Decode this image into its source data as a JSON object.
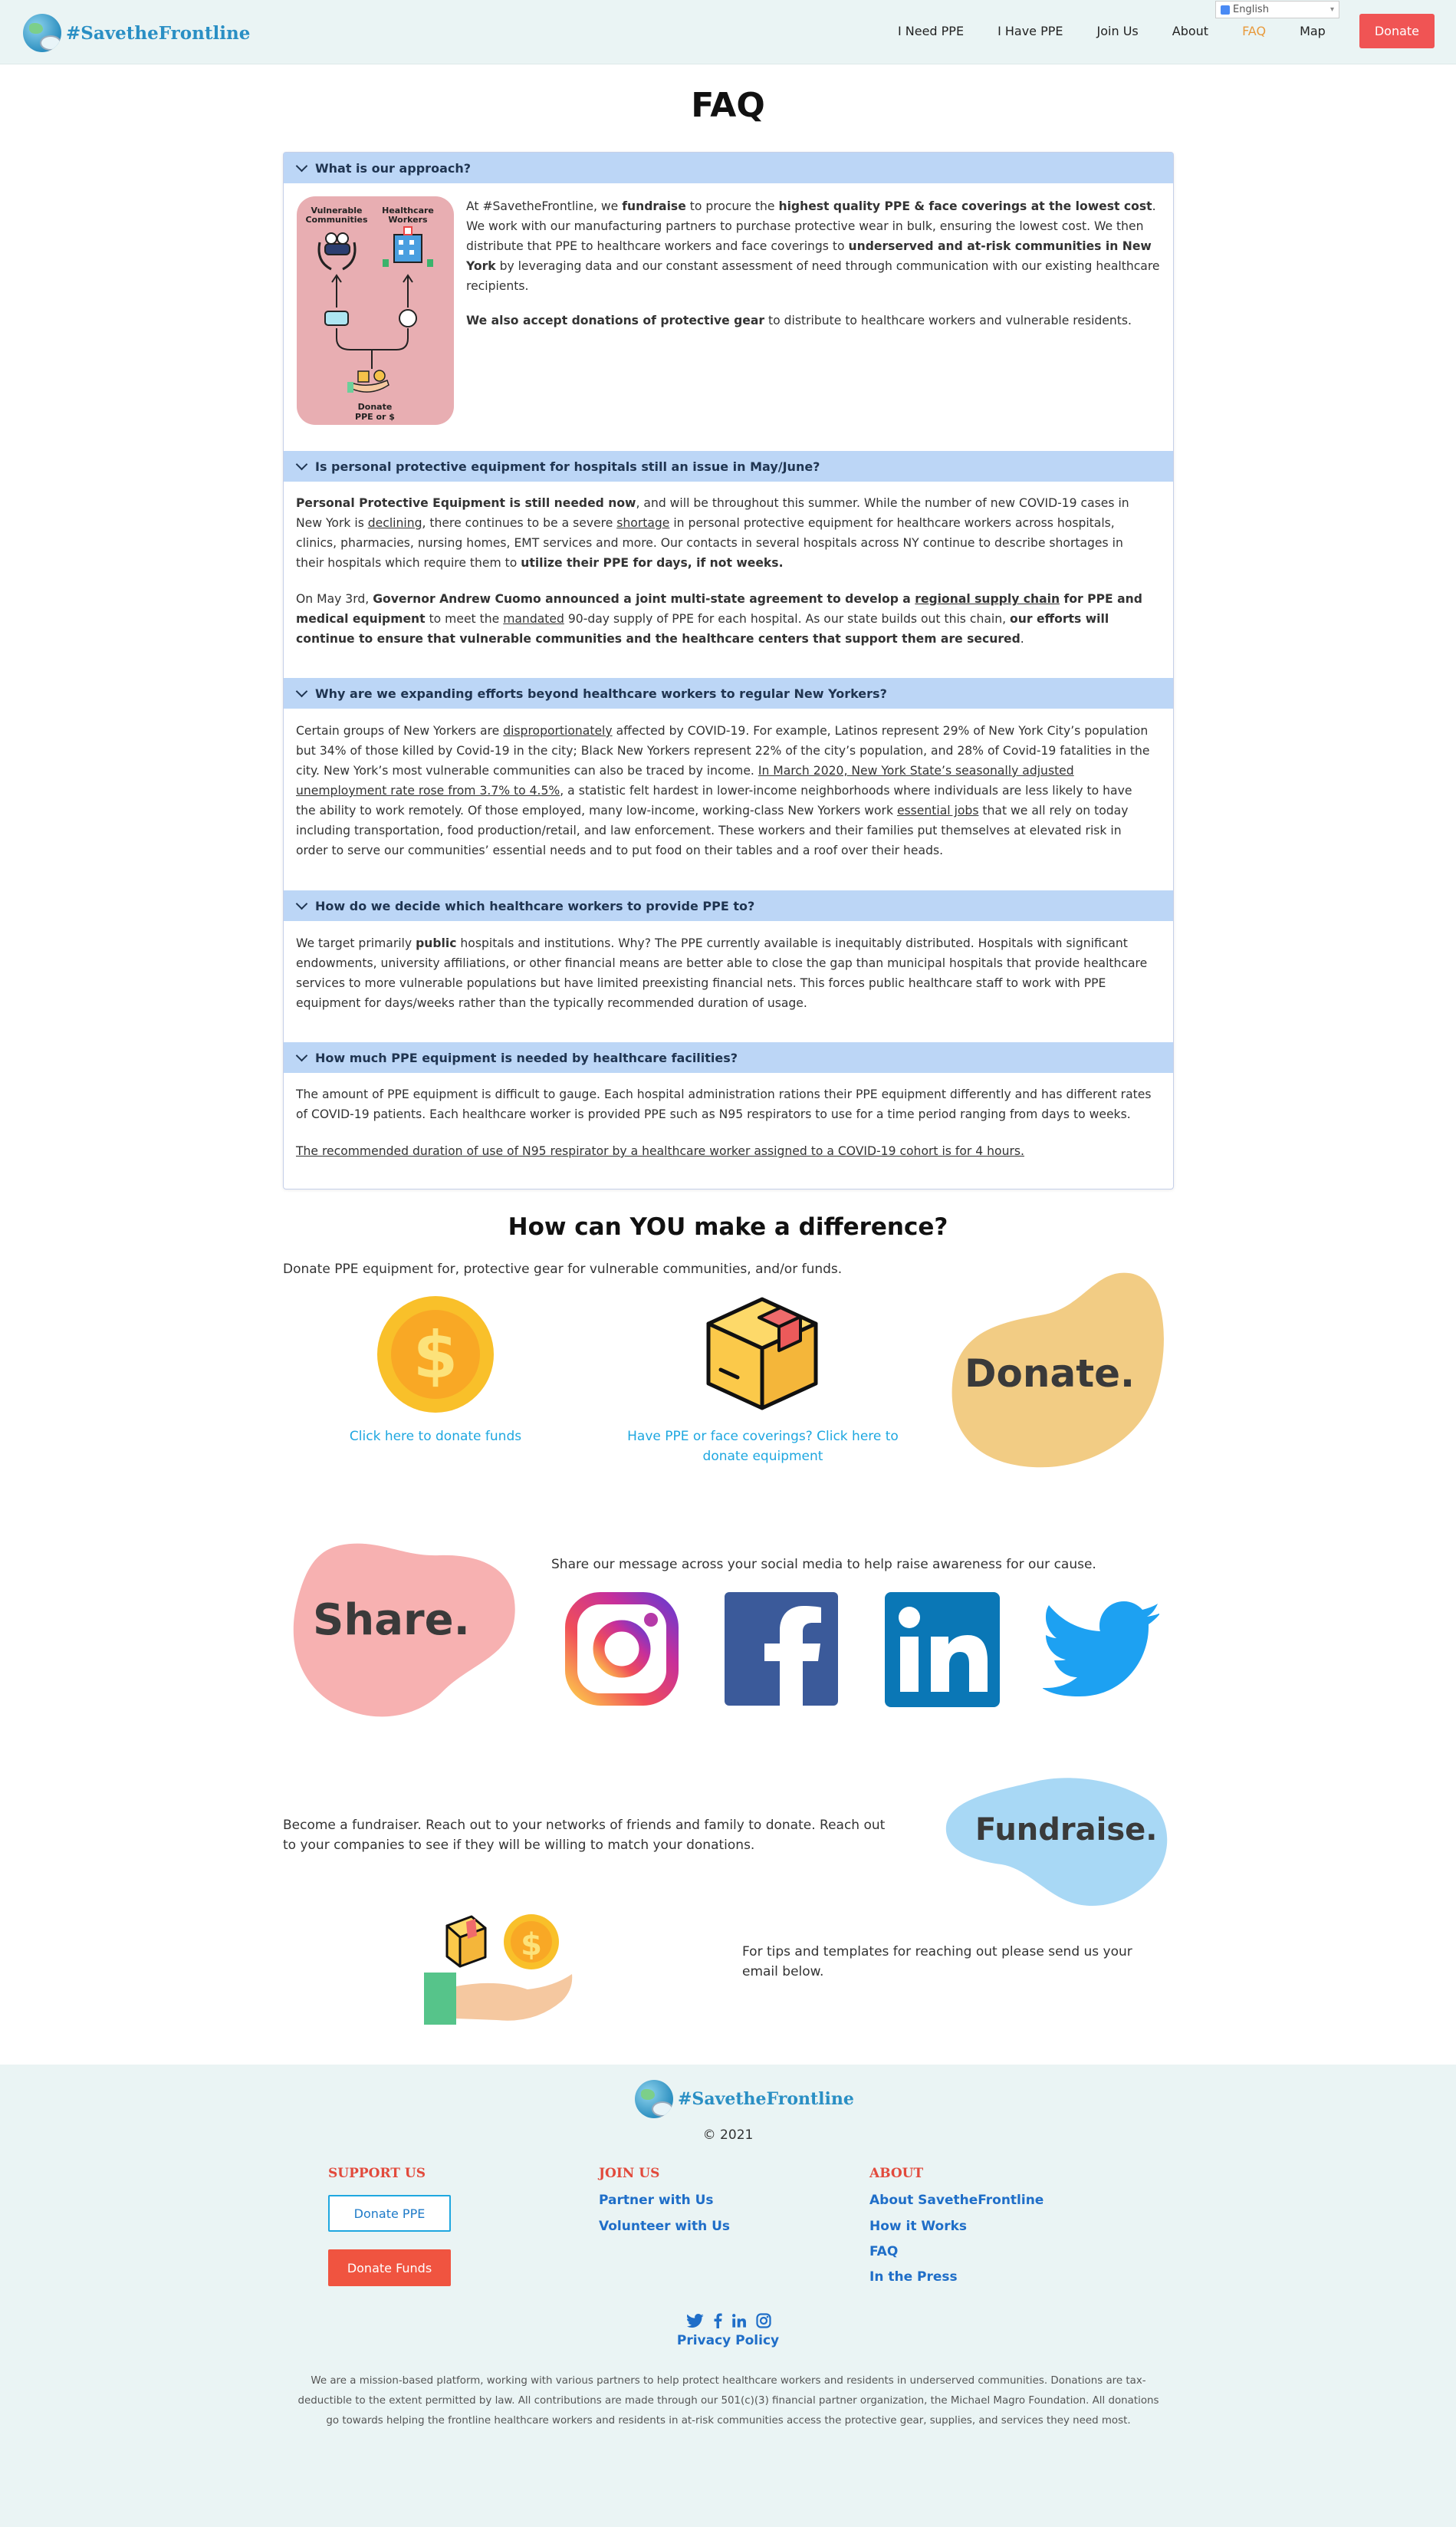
{
  "header": {
    "logo_text": "#SavetheFrontline",
    "language": "English",
    "nav": [
      "I Need PPE",
      "I Have PPE",
      "Join Us",
      "About",
      "FAQ",
      "Map"
    ],
    "donate": "Donate"
  },
  "faq": {
    "title": "FAQ",
    "q1": {
      "question": "What is our approach?",
      "graphic_labels": {
        "vulnerable": "Vulnerable Communities",
        "healthcare": "Healthcare Workers",
        "donate": "Donate PPE or $"
      },
      "p1": [
        {
          "t": "At #SavetheFrontline, we "
        },
        {
          "t": "fundraise",
          "b": true
        },
        {
          "t": " to procure the "
        },
        {
          "t": "highest quality PPE & face coverings at the lowest cost",
          "b": true
        },
        {
          "t": ". We work with our manufacturing partners to purchase protective wear in bulk, ensuring the lowest cost. We then distribute that PPE to healthcare workers and face coverings to "
        },
        {
          "t": "underserved and at-risk communities in New York",
          "b": true
        },
        {
          "t": " by leveraging data and our constant assessment of need through communication with our existing healthcare recipients."
        }
      ],
      "p2": [
        {
          "t": "We also accept donations of protective gear",
          "b": true
        },
        {
          "t": " to distribute to healthcare workers and vulnerable residents."
        }
      ]
    },
    "q2": {
      "question": "Is personal protective equipment for hospitals still an issue in May/June?",
      "p1": [
        {
          "t": "Personal Protective Equipment is still needed now",
          "b": true
        },
        {
          "t": ", and will be throughout this summer. While the number of new COVID-19 cases in New York is "
        },
        {
          "t": "declining",
          "u": true
        },
        {
          "t": ", there continues to be a severe "
        },
        {
          "t": "shortage",
          "u": true
        },
        {
          "t": " in personal protective equipment for healthcare workers across hospitals, clinics, pharmacies, nursing homes, EMT services and more. Our contacts in several hospitals across NY continue to describe shortages in their hospitals which require them to "
        },
        {
          "t": "utilize their PPE for days, if not weeks.",
          "b": true
        }
      ],
      "p2": [
        {
          "t": "On May 3rd, "
        },
        {
          "t": "Governor Andrew Cuomo announced a joint multi-state agreement to develop a ",
          "b": true
        },
        {
          "t": "regional supply chain",
          "b": true,
          "u": true
        },
        {
          "t": " for PPE and medical equipment",
          "b": true
        },
        {
          "t": " to meet the "
        },
        {
          "t": "mandated",
          "u": true
        },
        {
          "t": " 90-day supply of PPE for each hospital. As our state builds out this chain, "
        },
        {
          "t": "our efforts will continue to ensure that vulnerable communities and the healthcare centers that support them are secured",
          "b": true
        },
        {
          "t": "."
        }
      ]
    },
    "q3": {
      "question": "Why are we expanding efforts beyond healthcare workers to regular New Yorkers?",
      "p1": [
        {
          "t": "Certain groups of New Yorkers are "
        },
        {
          "t": "disproportionately",
          "u": true
        },
        {
          "t": " affected by COVID-19. For example, Latinos represent 29% of New York City’s population but 34% of those killed by Covid-19 in the city; Black New Yorkers represent 22% of the city’s population, and 28% of Covid-19 fatalities in the city. New York’s most vulnerable communities can also be traced by income. "
        },
        {
          "t": "In March 2020, New York State’s seasonally adjusted unemployment rate rose from 3.7% to 4.5%",
          "u": true
        },
        {
          "t": ", a statistic felt hardest in lower-income neighborhoods where individuals are less likely to have the ability to work remotely. Of those employed, many low-income, working-class New Yorkers work "
        },
        {
          "t": "essential jobs",
          "u": true
        },
        {
          "t": " that we all rely on today including transportation, food production/retail, and law enforcement. These workers and their families put themselves at elevated risk in order to serve our communities’ essential needs and to put food on their tables and a roof over their heads."
        }
      ]
    },
    "q4": {
      "question": "How do we decide which healthcare workers to provide PPE to?",
      "p1": [
        {
          "t": "We target primarily "
        },
        {
          "t": "public",
          "b": true
        },
        {
          "t": " hospitals and institutions. Why? The PPE currently available is inequitably distributed. Hospitals with significant endowments, university affiliations, or other financial means are better able to close the gap than municipal hospitals that provide healthcare services to more vulnerable populations but have limited preexisting financial nets. This forces public healthcare staff to work with PPE equipment for days/weeks rather than the typically recommended duration of usage."
        }
      ]
    },
    "q5": {
      "question": "How much PPE equipment is needed by healthcare facilities?",
      "p1": [
        {
          "t": "The amount of PPE equipment is difficult to gauge. Each hospital administration rations their PPE equipment differently and has different rates of COVID-19 patients. Each healthcare worker is provided PPE such as N95 respirators to use for a time period ranging from days to weeks."
        }
      ],
      "p2": [
        {
          "t": "The recommended duration of use of N95 respirator by a healthcare worker assigned to a COVID-19 cohort is for 4 hours.",
          "u": true
        }
      ]
    }
  },
  "difference": {
    "title": "How can YOU make a difference?",
    "intro": "Donate PPE equipment for, protective gear for vulnerable communities, and/or funds.",
    "donate_funds_link": "Click here to donate funds",
    "donate_equipment_link": "Have PPE or face coverings?  Click here to donate equipment",
    "donate_blob": "Donate.",
    "share_blob": "Share.",
    "share_text": "Share our message across your social media to help raise awareness for our cause.",
    "fundraise_text": "Become a fundraiser. Reach out to your networks of friends and family to donate. Reach out to your companies to see if they will be willing to match your donations.",
    "fundraise_blob": "Fundraise.",
    "tips_text": "For tips and templates for reaching out please send us your email below."
  },
  "footer": {
    "logo_text": "#SavetheFrontline",
    "copyright": "© 2021",
    "support_heading": "SUPPORT US",
    "donate_ppe": "Donate PPE",
    "donate_funds": "Donate Funds",
    "join_heading": "JOIN US",
    "join_links": [
      "Partner with Us",
      "Volunteer with Us"
    ],
    "about_heading": "ABOUT",
    "about_links": [
      "About SavetheFrontline",
      "How it Works",
      "FAQ",
      "In the Press"
    ],
    "privacy": "Privacy Policy",
    "about_text": "We are a mission-based platform, working with various partners to help protect healthcare workers and residents in underserved communities. Donations are tax-deductible to the extent permitted by law. All contributions are made through our 501(c)(3) financial partner organization, the Michael Magro Foundation. All donations go towards helping the frontline healthcare workers and residents in at-risk communities access the protective gear, supplies, and services they need most."
  },
  "colors": {
    "accent": "#f05454",
    "nav_active": "#e89a3c",
    "faq_header": "#bcd6f6",
    "link": "#1ea7e0",
    "footer_bg": "#eaf4f4"
  }
}
